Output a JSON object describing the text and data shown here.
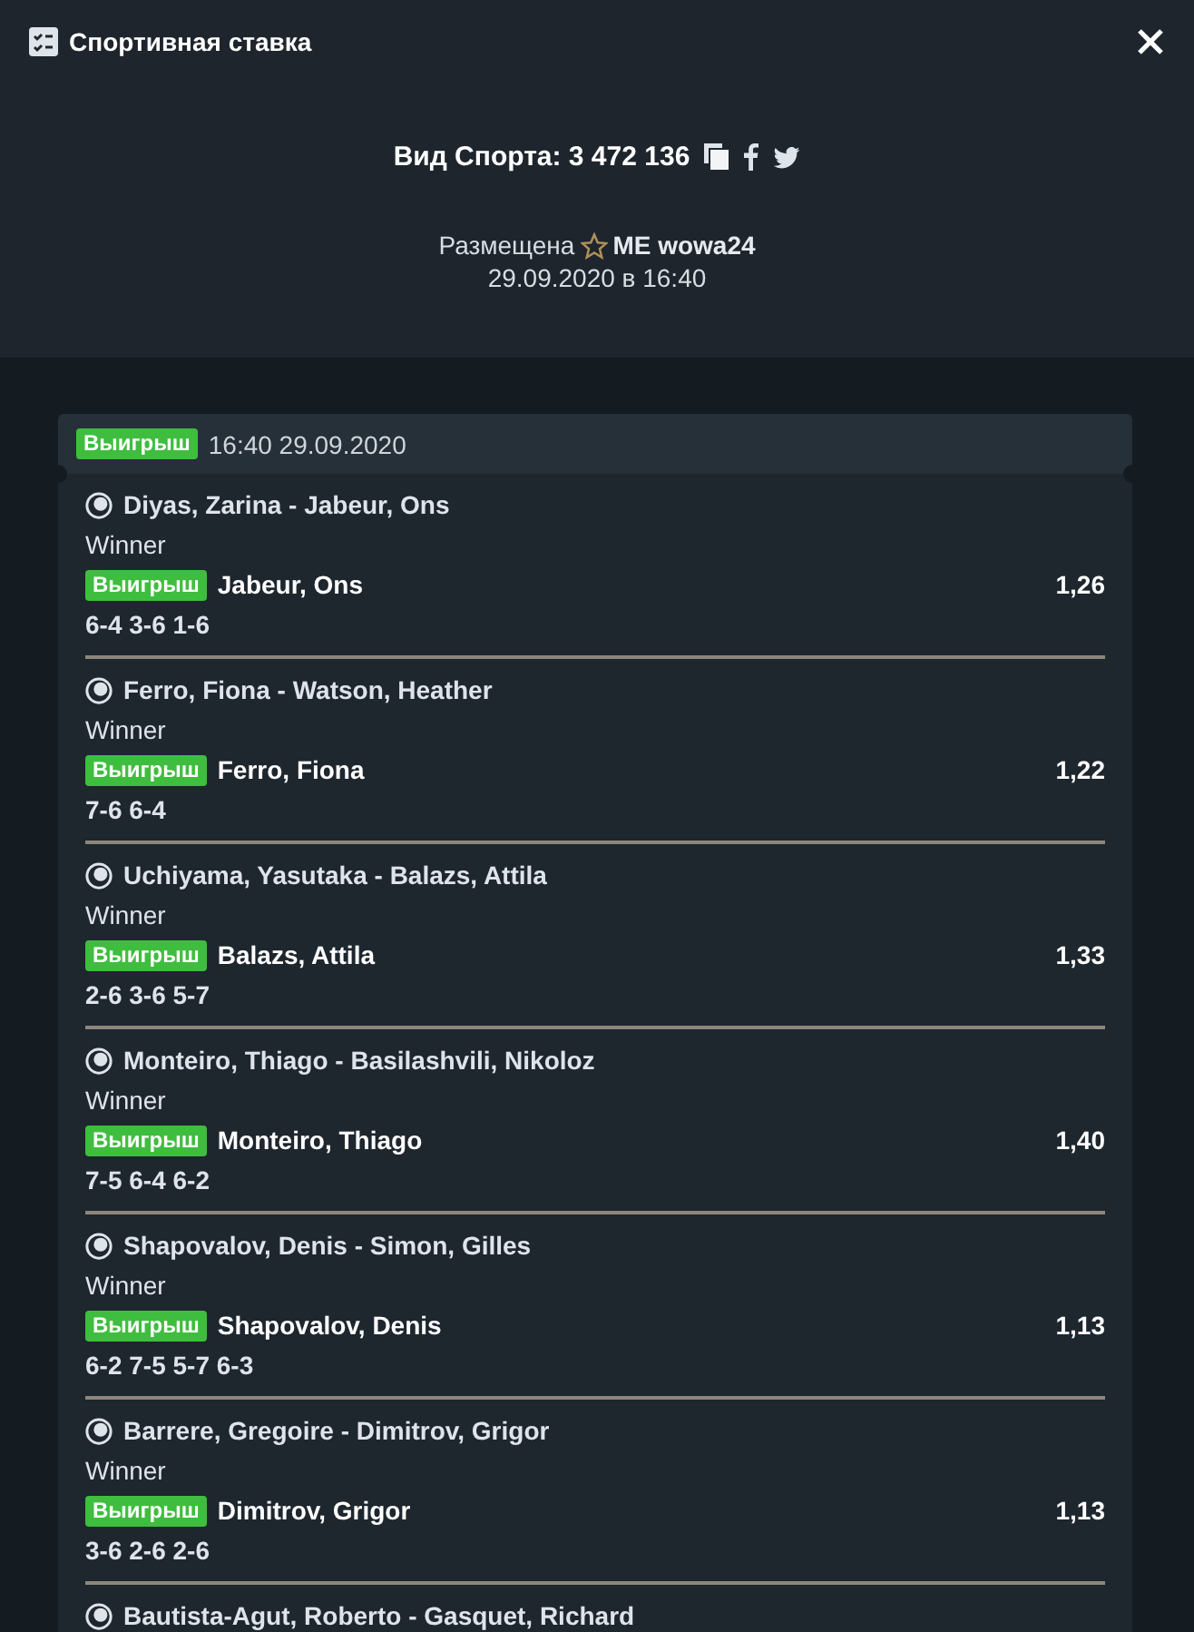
{
  "window": {
    "title": "Спортивная ставка"
  },
  "bet": {
    "label": "Вид Спорта: 3 472 136",
    "placed_label": "Размещена",
    "user": "ME wowa24",
    "date": "29.09.2020 в 16:40"
  },
  "slip": {
    "status": {
      "label": "Выигрыш",
      "kind": "won"
    },
    "time": "16:40 29.09.2020"
  },
  "selections": [
    {
      "event": "Diyas, Zarina - Jabeur, Ons",
      "market": "Winner",
      "status": {
        "label": "Выигрыш",
        "kind": "won"
      },
      "pick": "Jabeur, Ons",
      "odds": "1,26",
      "score": "6-4 3-6 1-6"
    },
    {
      "event": "Ferro, Fiona - Watson, Heather",
      "market": "Winner",
      "status": {
        "label": "Выигрыш",
        "kind": "won"
      },
      "pick": "Ferro, Fiona",
      "odds": "1,22",
      "score": "7-6 6-4"
    },
    {
      "event": "Uchiyama, Yasutaka - Balazs, Attila",
      "market": "Winner",
      "status": {
        "label": "Выигрыш",
        "kind": "won"
      },
      "pick": "Balazs, Attila",
      "odds": "1,33",
      "score": "2-6 3-6 5-7"
    },
    {
      "event": "Monteiro, Thiago - Basilashvili, Nikoloz",
      "market": "Winner",
      "status": {
        "label": "Выигрыш",
        "kind": "won"
      },
      "pick": "Monteiro, Thiago",
      "odds": "1,40",
      "score": "7-5 6-4 6-2"
    },
    {
      "event": "Shapovalov, Denis - Simon, Gilles",
      "market": "Winner",
      "status": {
        "label": "Выигрыш",
        "kind": "won"
      },
      "pick": "Shapovalov, Denis",
      "odds": "1,13",
      "score": "6-2 7-5 5-7 6-3"
    },
    {
      "event": "Barrere, Gregoire - Dimitrov, Grigor",
      "market": "Winner",
      "status": {
        "label": "Выигрыш",
        "kind": "won"
      },
      "pick": "Dimitrov, Grigor",
      "odds": "1,13",
      "score": "3-6 2-6 2-6"
    },
    {
      "event": "Bautista-Agut, Roberto - Gasquet, Richard"
    }
  ]
}
